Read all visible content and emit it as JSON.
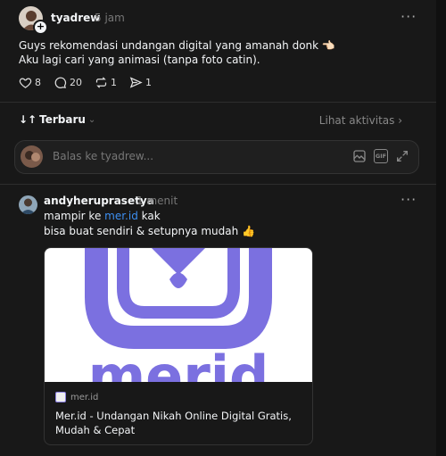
{
  "post": {
    "username": "tyadrew",
    "time": "5 jam",
    "line1": "Guys rekomendasi undangan digital yang amanah donk 👈🏻",
    "line2": "Aku lagi cari yang animasi (tanpa foto catin).",
    "likes": "8",
    "comments": "20",
    "reposts": "1",
    "shares": "1",
    "more": "···"
  },
  "sort": {
    "label": "Terbaru",
    "activity_link": "Lihat aktivitas ›"
  },
  "reply_box": {
    "placeholder": "Balas ke tyadrew...",
    "gif_label": "GIF"
  },
  "comment": {
    "username": "andyheruprasetya",
    "time": "1 menit",
    "text_before_link": "mampir ke ",
    "link": "mer.id",
    "text_after_link": " kak",
    "line2": "bisa buat sendiri & setupnya mudah 👍",
    "more": "···",
    "card": {
      "domain": "mer.id",
      "title": "Mer.id - Undangan Nikah Online Digital Gratis, Mudah & Cepat",
      "logo_text": "merid"
    }
  },
  "colors": {
    "background": "#181818",
    "link": "#3d8ff2",
    "brand_purple": "#7b70e0"
  },
  "icons": [
    "heart-icon",
    "comment-icon",
    "repost-icon",
    "share-icon",
    "image-icon",
    "gif-icon",
    "expand-icon",
    "more-icon",
    "sort-icon",
    "chevron-down-icon"
  ]
}
